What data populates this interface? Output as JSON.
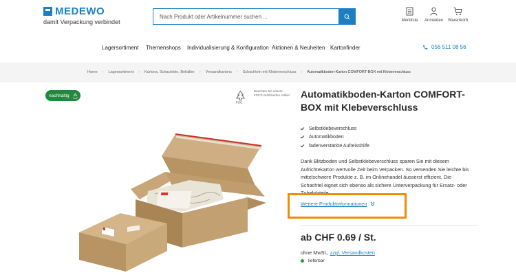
{
  "header": {
    "brand": "MEDEWO",
    "tagline": "damit Verpackung verbindet",
    "search_placeholder": "Nach Produkt oder Artikelnummer suchen ...",
    "icons": [
      {
        "label": "Merkliste",
        "icon": "clipboard-icon"
      },
      {
        "label": "Anmelden",
        "icon": "user-icon"
      },
      {
        "label": "Warenkorb",
        "icon": "cart-icon"
      }
    ]
  },
  "nav": {
    "items": [
      "Lagersortiment",
      "Themenshops",
      "Individualisierung & Konfiguration",
      "Aktionen & Neuheiten",
      "Kartonfinder"
    ],
    "phone": "056 511 08 56"
  },
  "breadcrumb": [
    "Home",
    "Lagersortiment",
    "Kartons, Schachteln, Behälter",
    "Versandkartons",
    "Schachteln mit Klebeverschluss",
    "Automatikboden-Karton COMFORT-BOX mit Klebeverschluss"
  ],
  "gallery": {
    "badge": "nachhaltig",
    "fsc_text": "Beachten Sie unsere FSC®-zertifizierten Artikel"
  },
  "product": {
    "title": "Automatikboden-Karton COMFORT-BOX mit Klebeverschluss",
    "features": [
      "Selbstklebeverschluss",
      "Automatikboden",
      "fadenverstärkte Aufreisshilfe"
    ],
    "description": "Dank Blitzboden und Selbstklebeverschluss sparen Sie mit diesem Aufrichtekarton wertvolle Zeit beim Verpacken. So versenden Sie leichte bis mittelschwere Produkte z. B. im Onlinehandel äusserst effizient. Die Schachtel eignet sich ebenso als sichere Unterverpackung für Ersatz- oder Zubehörteile.",
    "more_link": "Weitere Produktinformationen",
    "price": "ab CHF 0.69 / St.",
    "tax_prefix": "ohne MwSt.,",
    "shipping_link": "zzgl. Versandkosten",
    "stock": "lieferbar"
  },
  "colors": {
    "brand": "#1d7fc1",
    "highlight": "#f08c00",
    "badge": "#1f8a3d",
    "stock": "#2a9a3b"
  }
}
